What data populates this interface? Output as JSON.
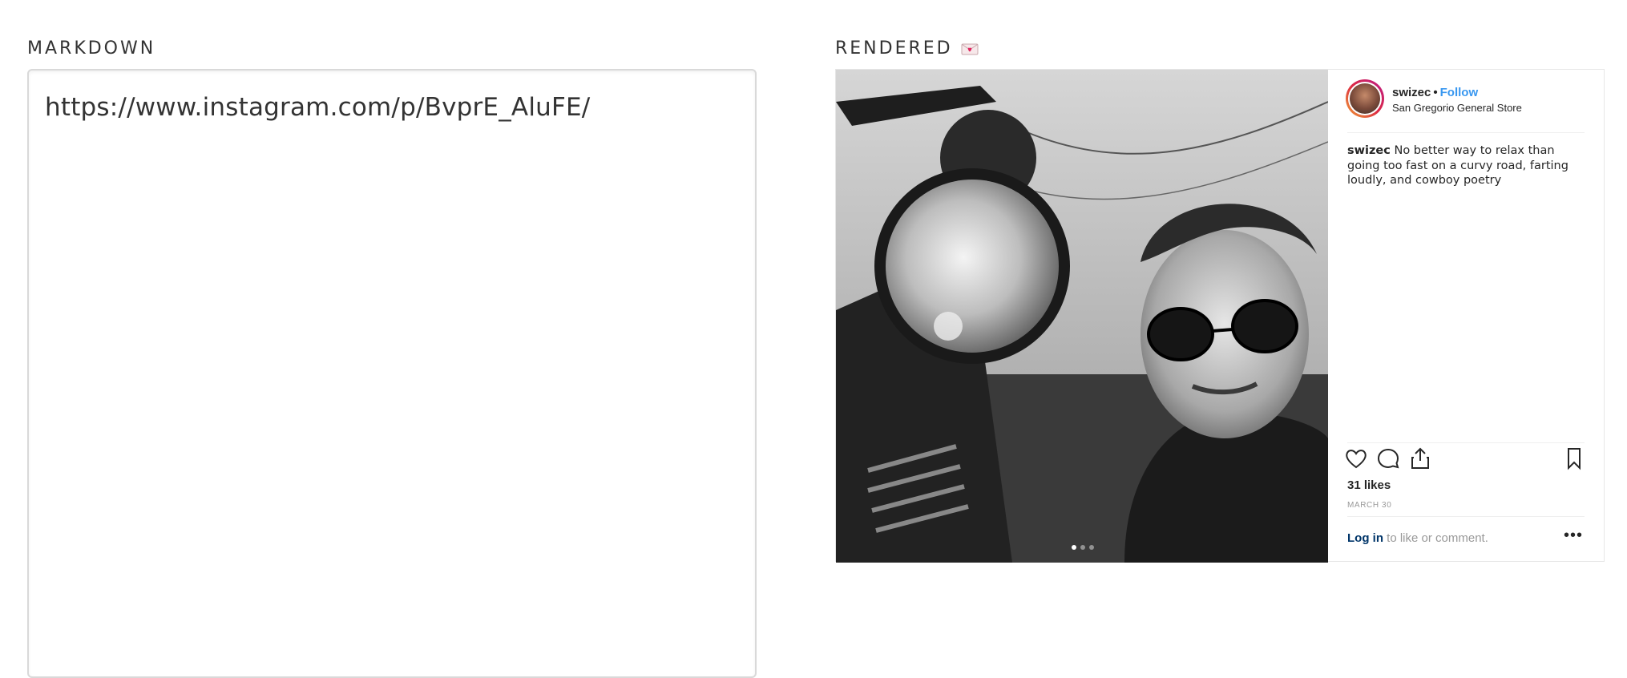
{
  "labels": {
    "markdown": "MARKDOWN",
    "rendered": "RENDERED",
    "rendered_emoji": "love-letter-icon"
  },
  "editor": {
    "value": "https://www.instagram.com/p/BvprE_AluFE/"
  },
  "embed": {
    "username": "swizec",
    "separator": "•",
    "follow": "Follow",
    "location": "San Gregorio General Store",
    "caption_user": "swizec",
    "caption_text": "No better way to relax than going too fast on a curvy road, farting loudly, and cowboy poetry",
    "likes": "31 likes",
    "date": "MARCH 30",
    "login": "Log in",
    "login_suffix": " to like or comment.",
    "more": "•••",
    "carousel_count": 3,
    "carousel_active_index": 0,
    "icons": [
      "heart-icon",
      "comment-icon",
      "share-icon",
      "bookmark-icon"
    ],
    "colors": {
      "follow": "#3897f0",
      "login": "#003569"
    }
  }
}
